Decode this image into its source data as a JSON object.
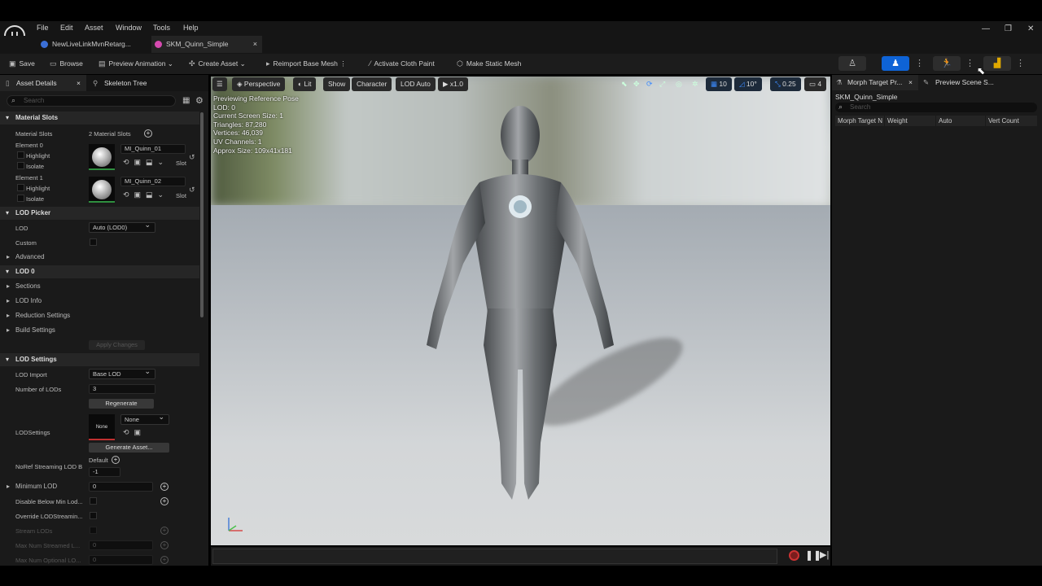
{
  "menu": [
    "File",
    "Edit",
    "Asset",
    "Window",
    "Tools",
    "Help"
  ],
  "tabs": [
    {
      "label": "NewLiveLinkMvnRetarg..."
    },
    {
      "label": "SKM_Quinn_Simple"
    }
  ],
  "toolbar": {
    "save": "Save",
    "browse": "Browse",
    "preview_animation": "Preview Animation",
    "create_asset": "Create Asset",
    "reimport": "Reimport Base Mesh",
    "cloth": "Activate Cloth Paint",
    "static_mesh": "Make Static Mesh"
  },
  "left_panel": {
    "tab_details": "Asset Details",
    "tab_skeleton": "Skeleton Tree",
    "search_placeholder": "Search",
    "material_slots": {
      "header": "Material Slots",
      "label": "Material Slots",
      "count": "2 Material Slots",
      "elements": [
        {
          "name": "Element 0",
          "material": "MI_Quinn_01",
          "highlight": "Highlight",
          "isolate": "Isolate",
          "slot": "Slot"
        },
        {
          "name": "Element 1",
          "material": "MI_Quinn_02",
          "highlight": "Highlight",
          "isolate": "Isolate",
          "slot": "Slot"
        }
      ]
    },
    "lod_picker": {
      "header": "LOD Picker",
      "lod_label": "LOD",
      "lod_value": "Auto (LOD0)",
      "custom": "Custom",
      "advanced": "Advanced"
    },
    "lod0": {
      "header": "LOD 0",
      "sections": "Sections",
      "info": "LOD Info",
      "reduction": "Reduction Settings",
      "build": "Build Settings",
      "apply": "Apply Changes"
    },
    "lod_settings": {
      "header": "LOD Settings",
      "import_label": "LOD Import",
      "import_value": "Base LOD",
      "num_label": "Number of LODs",
      "num_value": "3",
      "regenerate": "Regenerate",
      "lodsettings_label": "LODSettings",
      "thumb_none": "None",
      "none_value": "None",
      "generate": "Generate Asset...",
      "noref_label": "NoRef Streaming LOD B",
      "default": "Default",
      "noref_value": "-1",
      "min_lod": "Minimum LOD",
      "min_lod_value": "0",
      "disable_below": "Disable Below Min Lod...",
      "override": "Override LODStreamin...",
      "stream_lods": "Stream LODs",
      "max_streamed": "Max Num Streamed L...",
      "max_streamed_value": "0",
      "max_optional": "Max Num Optional LO...",
      "max_optional_value": "0"
    }
  },
  "viewport": {
    "perspective": "Perspective",
    "lit": "Lit",
    "show": "Show",
    "character": "Character",
    "lod_auto": "LOD Auto",
    "speed": "x1.0",
    "grid": "10",
    "angle": "10°",
    "scale": "0.25",
    "camera": "4",
    "stats": [
      "Previewing Reference Pose",
      "LOD: 0",
      "Current Screen Size: 1",
      "Triangles: 87,280",
      "Vertices: 46,039",
      "UV Channels: 1",
      "Approx Size: 109x41x181"
    ]
  },
  "right_panel": {
    "tab_morph": "Morph Target Pr...",
    "tab_scene": "Preview Scene S...",
    "asset": "SKM_Quinn_Simple",
    "search_placeholder": "Search",
    "columns": [
      "Morph Target N",
      "Weight",
      "Auto",
      "Vert Count"
    ]
  },
  "colors": {
    "accent": "#0e63d6",
    "panel": "#1a1a1a"
  }
}
